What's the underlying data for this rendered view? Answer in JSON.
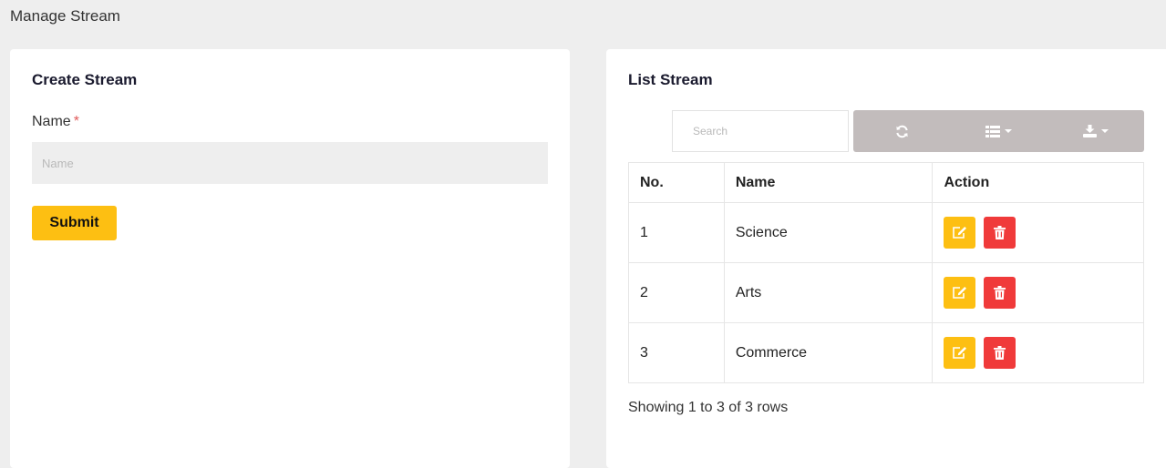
{
  "page": {
    "title": "Manage Stream"
  },
  "create": {
    "title": "Create Stream",
    "name_label": "Name",
    "required_mark": "*",
    "name_placeholder": "Name",
    "name_value": "",
    "submit_label": "Submit"
  },
  "list": {
    "title": "List Stream",
    "search_placeholder": "Search",
    "toolbar": {
      "refresh_icon": "refresh-icon",
      "columns_icon": "columns-list-icon",
      "export_icon": "download-icon"
    },
    "columns": [
      "No.",
      "Name",
      "Action"
    ],
    "rows": [
      {
        "no": "1",
        "name": "Science"
      },
      {
        "no": "2",
        "name": "Arts"
      },
      {
        "no": "3",
        "name": "Commerce"
      }
    ],
    "footer": "Showing 1 to 3 of 3 rows"
  },
  "colors": {
    "accent_yellow": "#fdbf12",
    "danger_red": "#f03a3a",
    "toolbar_gray": "#c2bcbc",
    "background": "#eeeeee"
  }
}
